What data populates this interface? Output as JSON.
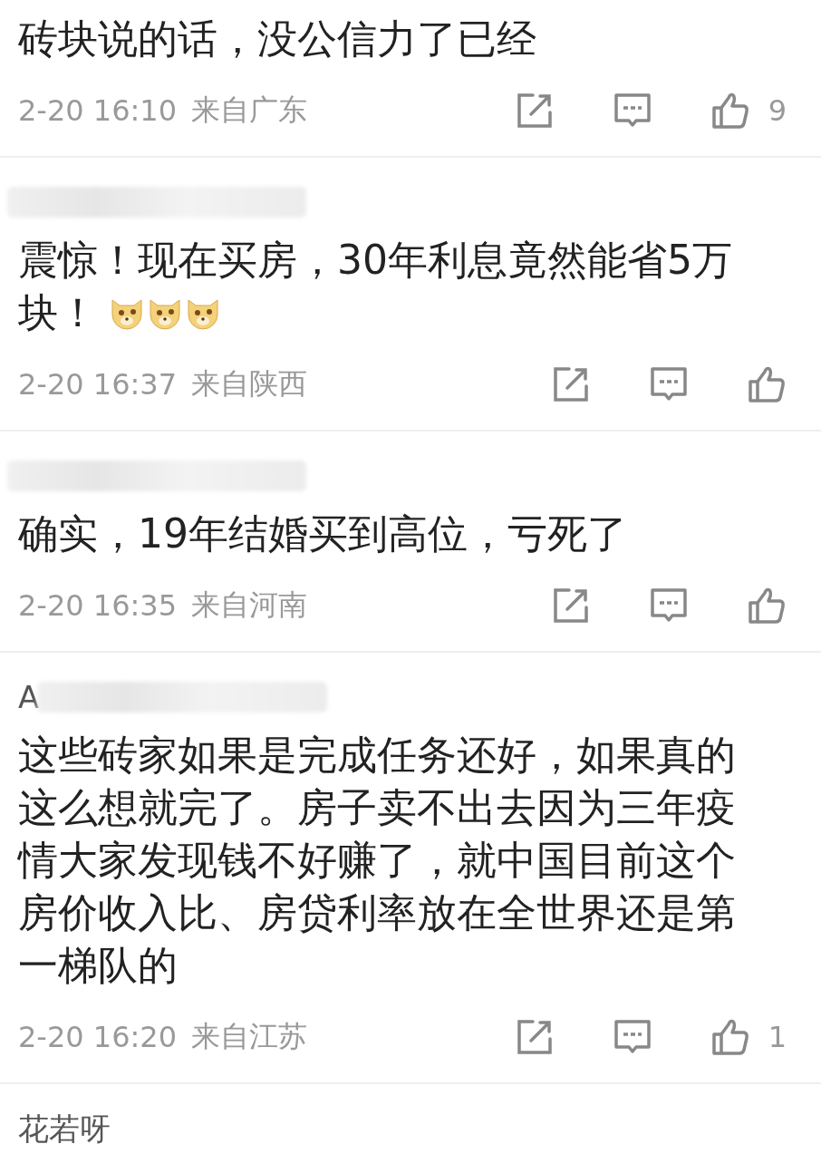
{
  "comments": [
    {
      "lines": [
        "砖块说的话，没公信力了已经"
      ],
      "time": "2-20 16:10",
      "location": "来自广东",
      "likes": "9"
    },
    {
      "author_hidden": true,
      "lines": [
        "震惊！现在买房，30年利息竟然能省5万",
        "块！"
      ],
      "stickers": [
        {
          "kind": "doge"
        },
        {
          "kind": "doge"
        },
        {
          "kind": "doge"
        }
      ],
      "time": "2-20 16:37",
      "location": "来自陕西"
    },
    {
      "author_hidden": true,
      "lines": [
        "确实，19年结婚买到高位，亏死了"
      ],
      "time": "2-20 16:35",
      "location": "来自河南"
    },
    {
      "author": "A",
      "author_hidden": true,
      "lines": [
        "这些砖家如果是完成任务还好，如果真的",
        "这么想就完了。房子卖不出去因为三年疫",
        "情大家发现钱不好赚了，就中国目前这个",
        "房价收入比、房贷利率放在全世界还是第",
        "一梯队的"
      ],
      "time": "2-20 16:20",
      "location": "来自江苏",
      "likes": "1"
    },
    {
      "author": "花若呀"
    }
  ]
}
